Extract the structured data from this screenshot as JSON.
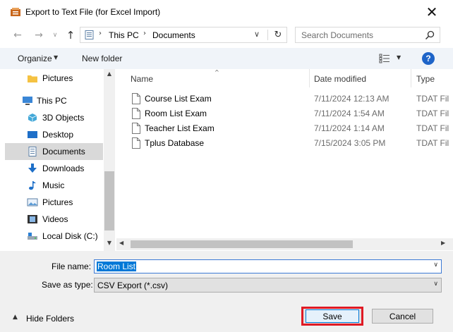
{
  "window": {
    "title": "Export to Text File (for Excel Import)",
    "close_glyph": "✕"
  },
  "nav": {
    "address": [
      "This PC",
      "Documents"
    ],
    "search_placeholder": "Search Documents"
  },
  "toolbar": {
    "organize": "Organize",
    "new_folder": "New folder",
    "help": "?"
  },
  "sidebar": {
    "items": [
      {
        "label": "Pictures",
        "icon": "folder-icon"
      },
      {
        "label": "This PC",
        "icon": "computer-icon"
      },
      {
        "label": "3D Objects",
        "icon": "3d-objects-icon"
      },
      {
        "label": "Desktop",
        "icon": "desktop-icon"
      },
      {
        "label": "Documents",
        "icon": "documents-icon",
        "selected": true
      },
      {
        "label": "Downloads",
        "icon": "download-icon"
      },
      {
        "label": "Music",
        "icon": "music-icon"
      },
      {
        "label": "Pictures",
        "icon": "pictures-icon"
      },
      {
        "label": "Videos",
        "icon": "videos-icon"
      },
      {
        "label": "Local Disk (C:)",
        "icon": "disk-icon"
      }
    ]
  },
  "files": {
    "columns": [
      "Name",
      "Date modified",
      "Type"
    ],
    "rows": [
      {
        "name": "Course List Exam",
        "date": "7/11/2024 12:13 AM",
        "type": "TDAT Fil"
      },
      {
        "name": "Room List Exam",
        "date": "7/11/2024 1:54 AM",
        "type": "TDAT Fil"
      },
      {
        "name": "Teacher List Exam",
        "date": "7/11/2024 1:14 AM",
        "type": "TDAT Fil"
      },
      {
        "name": "Tplus Database",
        "date": "7/15/2024 3:05 PM",
        "type": "TDAT Fil"
      }
    ]
  },
  "form": {
    "file_name_label": "File name:",
    "file_name_value": "Room List",
    "save_type_label": "Save as type:",
    "save_type_value": "CSV Export (*.csv)"
  },
  "footer": {
    "hide_folders": "Hide Folders",
    "save": "Save",
    "cancel": "Cancel"
  },
  "colors": {
    "accent": "#0078d7",
    "highlight": "#e01a24",
    "help": "#1e64c8"
  }
}
